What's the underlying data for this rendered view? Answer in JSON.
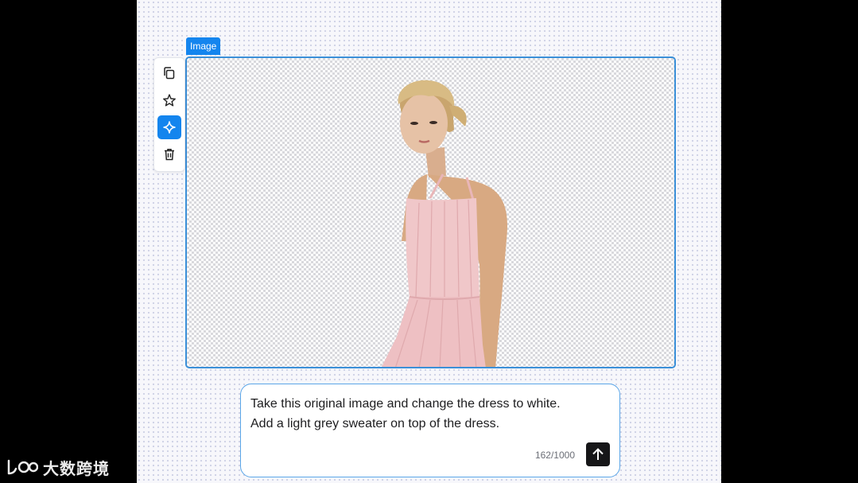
{
  "frame": {
    "tag_label": "Image"
  },
  "toolbar": {
    "items": [
      {
        "icon": "copy-icon"
      },
      {
        "icon": "star-icon"
      },
      {
        "icon": "sparkle-icon",
        "active": true
      },
      {
        "icon": "trash-icon"
      }
    ]
  },
  "prompt": {
    "text_line1": "Take this original image and change the dress to white.",
    "text_line2": "Add a light grey sweater on top of the dress.",
    "char_count": "162/1000",
    "send_icon": "arrow-up-icon"
  },
  "watermark": {
    "text": "大数跨境"
  },
  "colors": {
    "accent": "#1485ee",
    "frame_border": "#3a8fd8",
    "send_button": "#161618",
    "dress": "#f0c7c9"
  }
}
